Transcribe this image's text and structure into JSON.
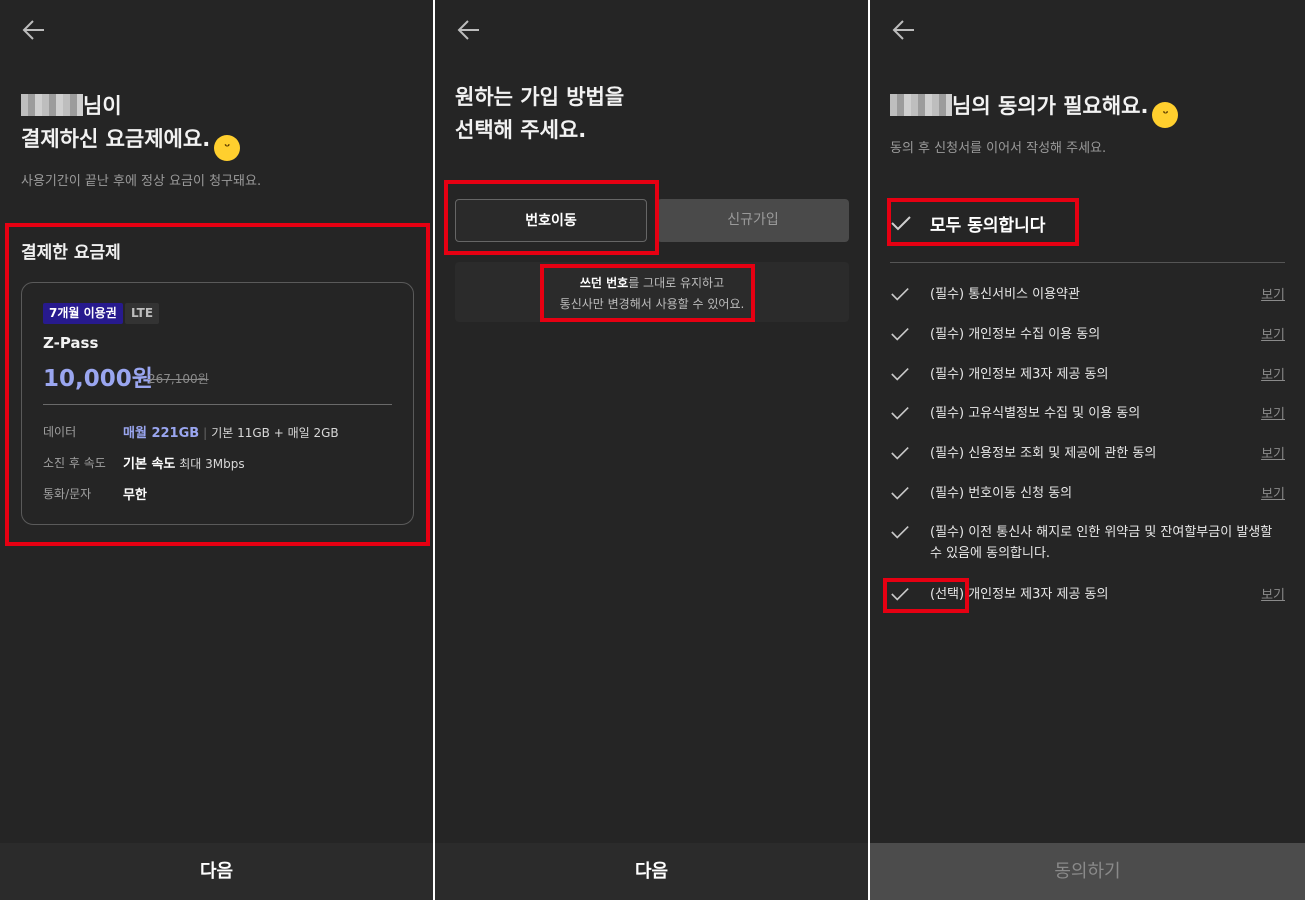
{
  "screen1": {
    "title_suffix_line1": "님이",
    "title_line2": "결제하신 요금제에요.",
    "subtitle": "사용기간이 끝난 후에 정상 요금이 청구돼요.",
    "section_title": "결제한 요금제",
    "card": {
      "badge_period": "7개월 이용권",
      "badge_network": "LTE",
      "plan_name": "Z-Pass",
      "price": "10,000원",
      "original_price": "267,100원",
      "rows": [
        {
          "label": "데이터",
          "highlight": "매월 221GB",
          "detail": "기본 11GB + 매일 2GB"
        },
        {
          "label": "소진 후 속도",
          "strong": "기본 속도",
          "detail": "최대 3Mbps"
        },
        {
          "label": "통화/문자",
          "strong": "무한"
        }
      ]
    },
    "next_label": "다음"
  },
  "screen2": {
    "title_line1": "원하는 가입 방법을",
    "title_line2": "선택해 주세요.",
    "tab_port": "번호이동",
    "tab_new": "신규가입",
    "desc_strong": "쓰던 번호",
    "desc_line1_rest": "를 그대로 유지하고",
    "desc_line2": "통신사만 변경해서 사용할 수 있어요.",
    "next_label": "다음"
  },
  "screen3": {
    "title_suffix": "님의 동의가 필요해요.",
    "subtitle": "동의 후 신청서를 이어서 작성해 주세요.",
    "agree_all": "모두 동의합니다",
    "view_label": "보기",
    "terms": [
      {
        "label": "(필수) 통신서비스 이용약관",
        "has_view": true
      },
      {
        "label": "(필수) 개인정보 수집 이용 동의",
        "has_view": true
      },
      {
        "label": "(필수) 개인정보 제3자 제공 동의",
        "has_view": true
      },
      {
        "label": "(필수) 고유식별정보 수집 및 이용 동의",
        "has_view": true
      },
      {
        "label": "(필수) 신용정보 조회 및 제공에 관한 동의",
        "has_view": true
      },
      {
        "label": "(필수) 번호이동 신청 동의",
        "has_view": true
      },
      {
        "label": "(필수) 이전 통신사 해지로 인한 위약금 및 잔여할부금이 발생할 수 있음에 동의합니다.",
        "has_view": false
      },
      {
        "label": "(선택) 개인정보 제3자 제공 동의",
        "has_view": true
      }
    ],
    "submit_label": "동의하기"
  },
  "icons": {
    "back": "arrow-left-icon",
    "check": "check-icon",
    "emoji": "grinning-face-icon"
  },
  "colors": {
    "background": "#252525",
    "highlight": "#9aa6f0",
    "badge": "#271a8e",
    "annotation": "#e60012"
  }
}
